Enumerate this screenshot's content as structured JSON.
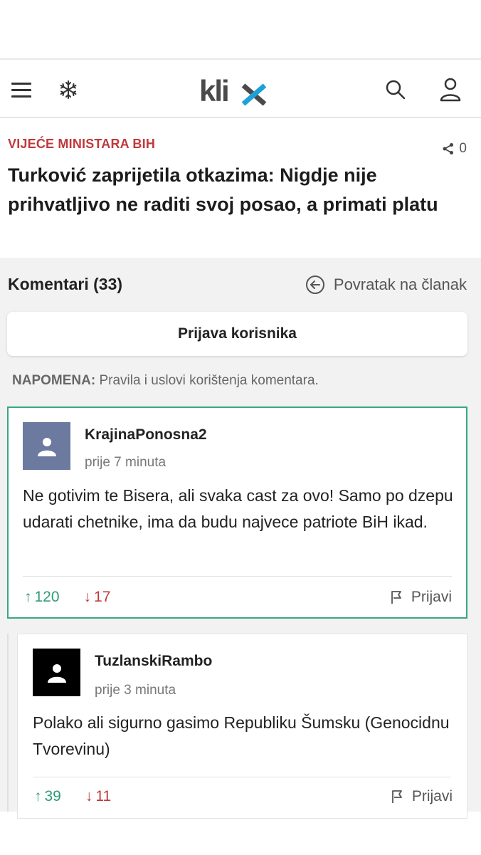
{
  "header": {
    "menu_icon": "hamburger-menu-icon",
    "secondary_icon": "snowflake-icon",
    "logo_text": "klix",
    "logo_colors": {
      "text": "#4a4a4a",
      "x_accent": "#1ea1d8"
    },
    "search_icon": "search-icon",
    "user_icon": "user-icon"
  },
  "article": {
    "category": "VIJEĆE MINISTARA BIH",
    "share_count": "0",
    "headline": "Turković zaprijetila otkazima: Nigdje nije prihvatljivo ne raditi svoj posao, a primati platu"
  },
  "comments_section": {
    "title": "Komentari (33)",
    "back_label": "Povratak na članak",
    "login_label": "Prijava korisnika",
    "note_label": "NAPOMENA:",
    "note_text": " Pravila i uslovi korištenja komentara."
  },
  "comments": [
    {
      "username": "KrajinaPonosna2",
      "time": "prije 7 minuta",
      "text": "Ne gotivim te Bisera, ali svaka cast za ovo! Samo po dzepu udarati chetnike, ima da budu najvece patriote BiH ikad.",
      "upvotes": "120",
      "downvotes": "17",
      "report_label": "Prijavi"
    },
    {
      "username": "TuzlanskiRambo",
      "time": "prije 3 minuta",
      "text": "Polako ali sigurno gasimo Republiku Šumsku (Genocidnu Tvorevinu)",
      "upvotes": "39",
      "downvotes": "11",
      "report_label": "Prijavi"
    }
  ],
  "colors": {
    "category_red": "#c0393b",
    "vote_up_green": "#2e9a78",
    "vote_down_red": "#c0393b",
    "highlight_border": "#3aa685"
  }
}
